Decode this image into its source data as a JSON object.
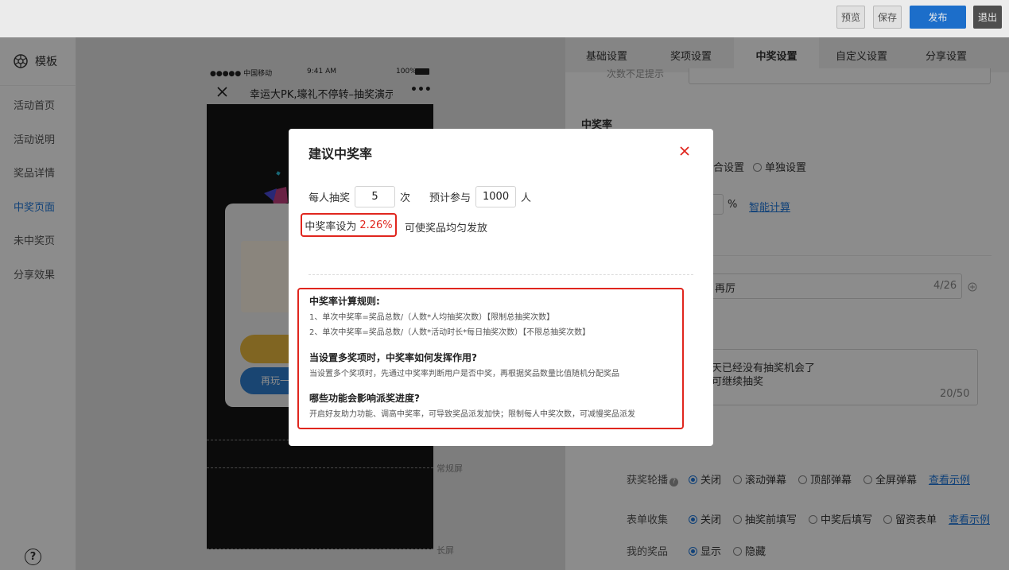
{
  "topbar": {
    "preview": "预览",
    "save": "保存",
    "publish": "发布",
    "exit": "退出"
  },
  "sidebar": {
    "title": "模板",
    "items": [
      "活动首页",
      "活动说明",
      "奖品详情",
      "中奖页面",
      "未中奖页",
      "分享效果"
    ],
    "help": "?"
  },
  "phone": {
    "carrier": "●●●●● 中国移动",
    "time": "9:41 AM",
    "battery": "100%",
    "nav_title": "幸运大PK,壕礼不停转–抽奖演示",
    "more": "•••",
    "replay_button": "再玩一",
    "normal_screen": "常规屏",
    "long_screen": "长屏"
  },
  "tabs": [
    "基础设置",
    "奖项设置",
    "中奖设置",
    "自定义设置",
    "分享设置"
  ],
  "right": {
    "partial_label": "次数不足提示",
    "rate_section": "中奖率",
    "rate_option_combined": "合设置",
    "rate_option_single": "单独设置",
    "percent": "%",
    "smart_calc": "智能计算",
    "name_value": "再厉",
    "name_count": "4/26",
    "msg_line1": "天已经没有抽奖机会了",
    "msg_line2": "可继续抽奖",
    "msg_count": "20/50",
    "carousel_label": "获奖轮播",
    "carousel_options": [
      "关闭",
      "滚动弹幕",
      "顶部弹幕",
      "全屏弹幕"
    ],
    "form_label": "表单收集",
    "form_options": [
      "关闭",
      "抽奖前填写",
      "中奖后填写",
      "留资表单"
    ],
    "see_example": "查看示例",
    "myprize_label": "我的奖品",
    "myprize_options": [
      "显示",
      "隐藏"
    ]
  },
  "modal": {
    "title": "建议中奖率",
    "per_person_label": "每人抽奖",
    "per_person_value": "5",
    "times_unit": "次",
    "participants_label": "预计参与",
    "participants_value": "1000",
    "people_unit": "人",
    "rate_label": "中奖率设为",
    "rate_value": "2.26%",
    "rate_hint": "可使奖品均匀发放",
    "rules": {
      "h1": "中奖率计算规则:",
      "r1": "1、单次中奖率=奖品总数/（人数*人均抽奖次数）【限制总抽奖次数】",
      "r2": "2、单次中奖率=奖品总数/（人数*活动时长*每日抽奖次数）【不限总抽奖次数】",
      "h2": "当设置多奖项时，中奖率如何发挥作用?",
      "t2": "当设置多个奖项时，先通过中奖率判断用户是否中奖，再根据奖品数量比值随机分配奖品",
      "h3": "哪些功能会影响派奖进度?",
      "t3": "开启好友助力功能、调高中奖率，可导致奖品派发加快；限制每人中奖次数，可减慢奖品派发"
    }
  },
  "colors": {
    "accent": "#1f78dc",
    "highlight": "#e0261e"
  }
}
